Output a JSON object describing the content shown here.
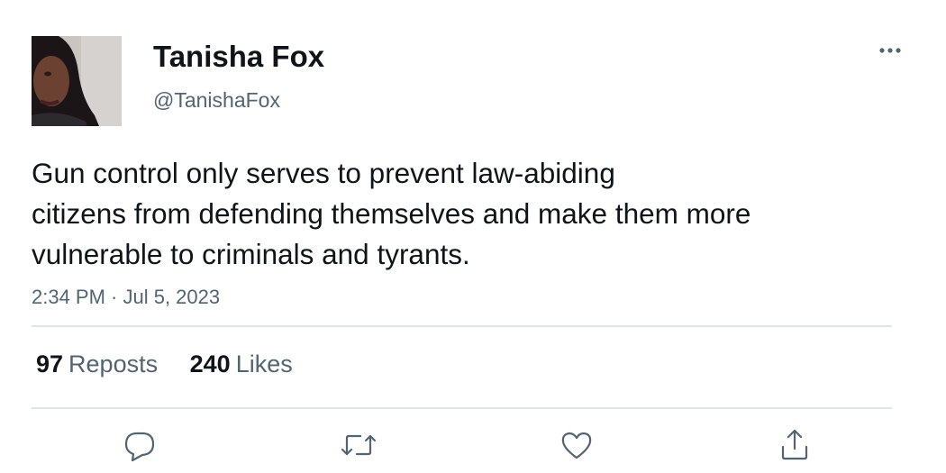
{
  "author": {
    "display_name": "Tanisha Fox",
    "handle": "@TanishaFox"
  },
  "tweet": {
    "text_lines": [
      "Gun control only serves to prevent law-abiding",
      "citizens from defending themselves and make them more",
      "vulnerable to criminals and tyrants."
    ],
    "timestamp": "2:34 PM · Jul 5, 2023"
  },
  "stats": {
    "reposts_count": "97",
    "reposts_label": "Reposts",
    "likes_count": "240",
    "likes_label": "Likes"
  },
  "actions": {
    "reply_icon": "reply-icon",
    "repost_icon": "repost-icon",
    "like_icon": "heart-icon",
    "share_icon": "share-icon"
  },
  "colors": {
    "text_primary": "#0f1419",
    "text_secondary": "#536471",
    "divider": "#e1e4e7",
    "background": "#ffffff"
  }
}
